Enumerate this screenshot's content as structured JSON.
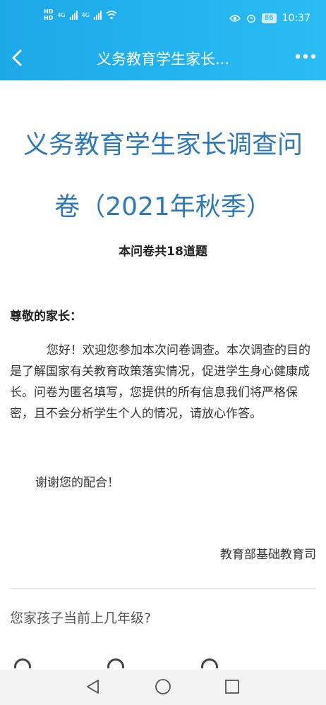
{
  "status_bar": {
    "network_a": "HD",
    "network_b": "HD",
    "signal1": "4G",
    "signal2": "4G",
    "battery": "86",
    "time": "10:37"
  },
  "nav": {
    "title": "义务教育学生家长...",
    "back_icon": "chevron-left-icon",
    "more_icon": "more-horizontal-icon"
  },
  "doc": {
    "title": "义务教育学生家长调查问卷（2021年秋季）",
    "question_count": "本问卷共18道题",
    "greeting": "尊敬的家长：",
    "body": "您好！欢迎您参加本次问卷调查。本次调查的目的是了解国家有关教育政策落实情况，促进学生身心健康成长。问卷为匿名填写，您提供的所有信息我们将严格保密，且不会分析学生个人的情况，请放心作答。",
    "thanks": "谢谢您的配合！",
    "signature": "教育部基础教育司"
  },
  "question1": {
    "text": "您家孩子当前上几年级?"
  },
  "colors": {
    "header_start": "#1da7e8",
    "header_end": "#2bbcf3",
    "title": "#2f79b6"
  }
}
